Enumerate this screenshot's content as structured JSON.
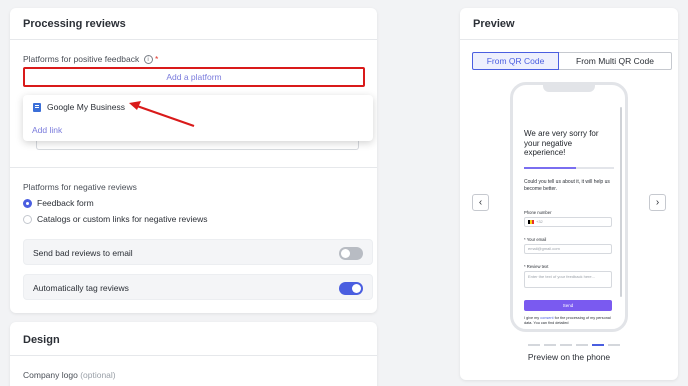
{
  "processing": {
    "title": "Processing reviews",
    "positive_label": "Platforms for positive feedback",
    "info_symbol": "i",
    "required_mark": "*",
    "add_platform": "Add a platform",
    "dropdown": {
      "item": "Google My Business",
      "add_link": "Add link"
    },
    "negative_label": "Platforms for negative reviews",
    "radio_options": [
      {
        "label": "Feedback form",
        "selected": true
      },
      {
        "label": "Catalogs or custom links for negative reviews",
        "selected": false
      }
    ],
    "toggles": [
      {
        "label": "Send bad reviews to email",
        "on": false
      },
      {
        "label": "Automatically tag reviews",
        "on": true
      }
    ]
  },
  "design": {
    "title": "Design",
    "logo_label": "Company logo",
    "logo_optional": "(optional)"
  },
  "preview": {
    "title": "Preview",
    "tabs": [
      {
        "label": "From QR Code",
        "active": true
      },
      {
        "label": "From Multi QR Code",
        "active": false
      }
    ],
    "phone": {
      "heading": "We are very sorry for your negative experience!",
      "subtext": "Could you tell us about it, it will help us become better.",
      "phone_label": "Phone number",
      "phone_prefix": "+32",
      "email_label": "* Your email",
      "email_placeholder": "email@gmail.com",
      "review_label": "* Review text",
      "review_placeholder": "Enter the text of your feedback here...",
      "send": "Send",
      "consent_pre": "I give my ",
      "consent_link": "consent",
      "consent_post": " for the processing of my personal data. You can find detailed"
    },
    "prev_arrow": "‹",
    "next_arrow": "›",
    "caption": "Preview on the phone",
    "page_dots": [
      false,
      false,
      false,
      false,
      true,
      false
    ]
  },
  "colors": {
    "accent": "#4a5ee0",
    "highlight": "#d91a1a",
    "send_button": "#7a5af0"
  }
}
